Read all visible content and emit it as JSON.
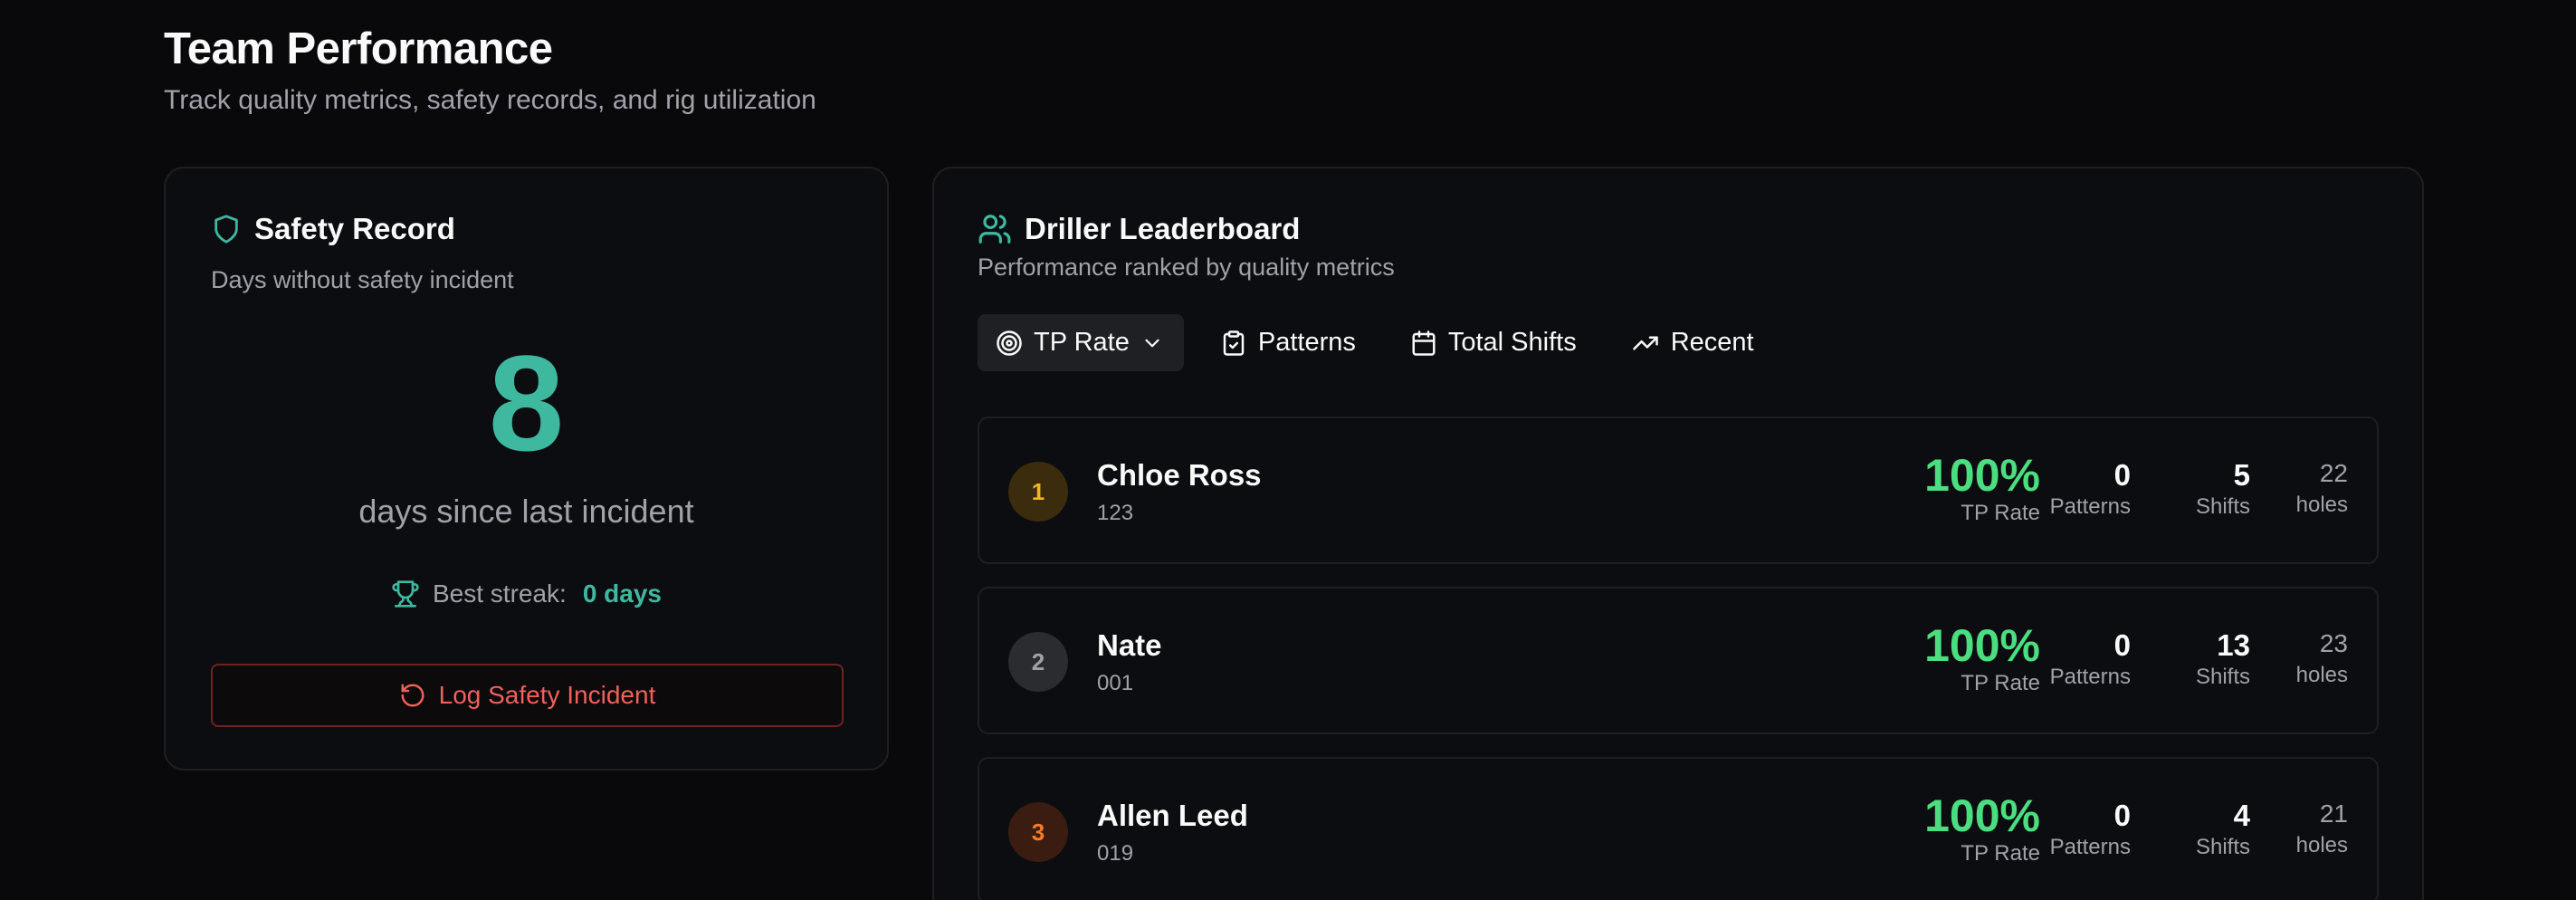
{
  "page": {
    "title": "Team Performance",
    "subtitle": "Track quality metrics, safety records, and rig utilization"
  },
  "safety": {
    "title": "Safety Record",
    "description": "Days without safety incident",
    "days_count": "8",
    "days_caption": "days since last incident",
    "streak_label": "Best streak:",
    "streak_value": "0 days",
    "log_button": "Log Safety Incident",
    "icons": {
      "header": "shield-icon",
      "streak": "trophy-icon",
      "log": "rotate-ccw-icon"
    },
    "colors": {
      "accent": "#3fb8a0",
      "danger": "#f0605c"
    }
  },
  "leaderboard": {
    "title": "Driller Leaderboard",
    "description": "Performance ranked by quality metrics",
    "header_icon": "users-icon",
    "sort_options": [
      {
        "label": "TP Rate",
        "icon": "target-icon",
        "active": true
      },
      {
        "label": "Patterns",
        "icon": "clipboard-check-icon",
        "active": false
      },
      {
        "label": "Total Shifts",
        "icon": "calendar-icon",
        "active": false
      },
      {
        "label": "Recent",
        "icon": "trending-up-icon",
        "active": false
      }
    ],
    "stat_labels": {
      "tp_rate": "TP Rate",
      "patterns": "Patterns",
      "shifts": "Shifts",
      "holes": "holes"
    },
    "rows": [
      {
        "rank": "1",
        "name": "Chloe Ross",
        "id": "123",
        "tp_rate": "100%",
        "patterns": "0",
        "shifts": "5",
        "holes": "22"
      },
      {
        "rank": "2",
        "name": "Nate",
        "id": "001",
        "tp_rate": "100%",
        "patterns": "0",
        "shifts": "13",
        "holes": "23"
      },
      {
        "rank": "3",
        "name": "Allen Leed",
        "id": "019",
        "tp_rate": "100%",
        "patterns": "0",
        "shifts": "4",
        "holes": "21"
      }
    ],
    "colors": {
      "tp_rate": "#4ade80",
      "rank_gold": "#f2b51f",
      "rank_silver": "#a1a1aa",
      "rank_bronze": "#f07b2c"
    }
  }
}
